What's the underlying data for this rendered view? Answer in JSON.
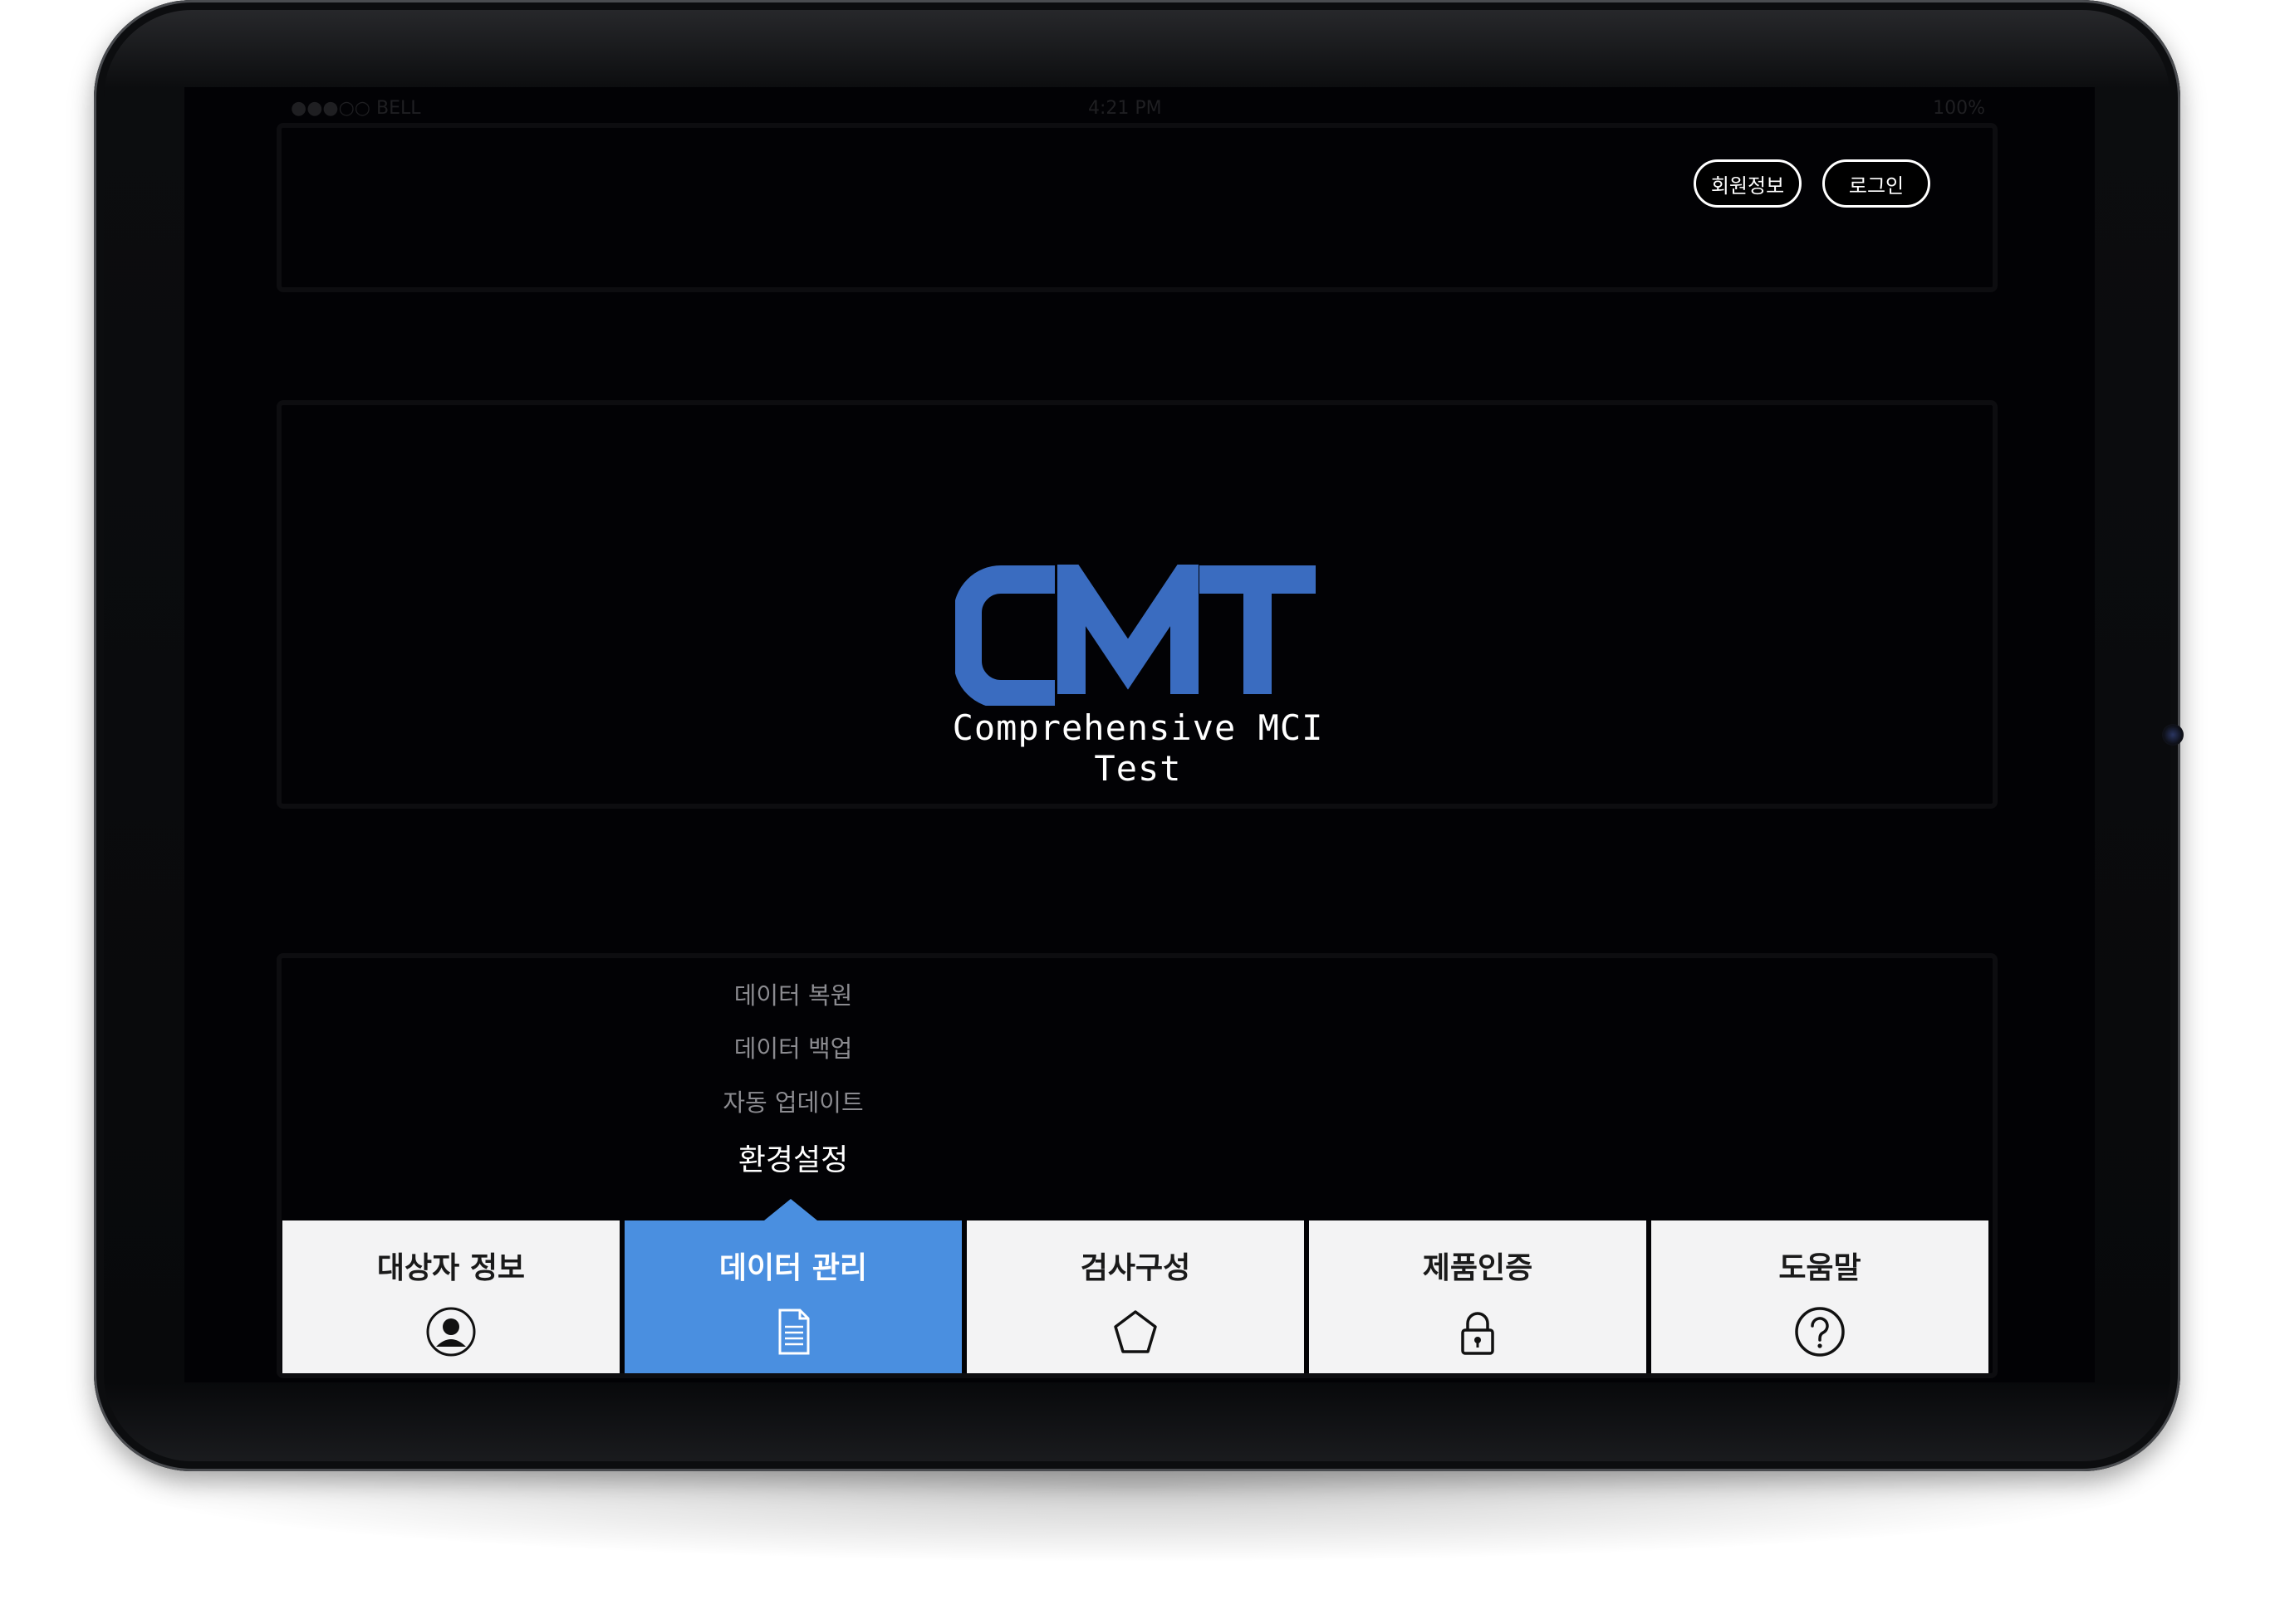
{
  "status_bar": {
    "carrier": "●●●○○ BELL",
    "time": "4:21 PM",
    "battery": "100%"
  },
  "header": {
    "member_info_label": "회원정보",
    "login_label": "로그인"
  },
  "logo": {
    "wordmark": "CMT",
    "tagline": "Comprehensive MCI Test",
    "color": "#3a6cc0"
  },
  "dropdown": {
    "items": [
      {
        "label": "데이터 복원"
      },
      {
        "label": "데이터 백업"
      },
      {
        "label": "자동 업데이트"
      },
      {
        "label": "환경설정",
        "active": true
      }
    ]
  },
  "tabs": [
    {
      "label": "대상자 정보",
      "icon": "person-icon",
      "active": false
    },
    {
      "label": "데이터 관리",
      "icon": "document-icon",
      "active": true
    },
    {
      "label": "검사구성",
      "icon": "pentagon-icon",
      "active": false
    },
    {
      "label": "제품인증",
      "icon": "lock-icon",
      "active": false
    },
    {
      "label": "도움말",
      "icon": "help-icon",
      "active": false
    }
  ],
  "colors": {
    "accent": "#4a8fe0",
    "tab_bg": "#f3f3f4",
    "screen_bg": "#020205"
  }
}
